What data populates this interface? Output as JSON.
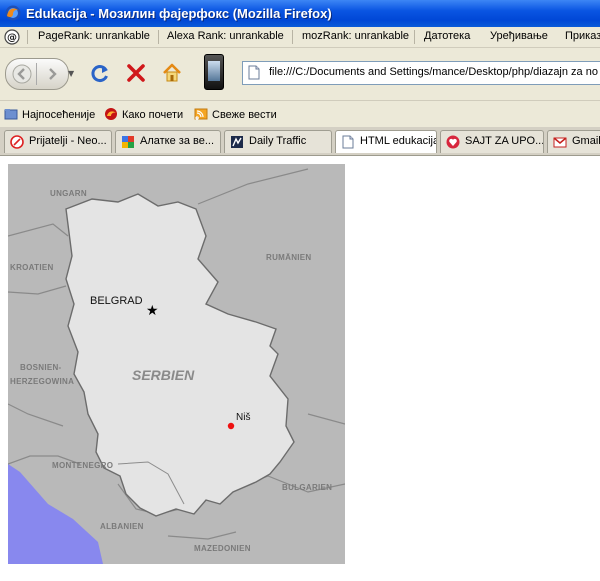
{
  "window": {
    "title": "Edukacija - Мозилин фајерфокс (Mozilla Firefox)"
  },
  "seo_toolbar": {
    "pagerank": "PageRank: unrankable",
    "alexa": "Alexa Rank: unrankable",
    "mozrank": "mozRank: unrankable",
    "menu_file": "Датотека",
    "menu_edit": "Уређивање",
    "menu_view": "Приказ"
  },
  "nav": {
    "url": "file:///C:/Documents and Settings/mance/Desktop/php/diazajn za no"
  },
  "bookmarks": [
    {
      "label": "Најпосећеније",
      "icon": "bookmark-folder-icon"
    },
    {
      "label": "Како почети",
      "icon": "firefox-red-icon"
    },
    {
      "label": "Свеже вести",
      "icon": "rss-feed-icon"
    }
  ],
  "tabs": [
    {
      "label": "Prijatelji - Neo...",
      "icon": "neo-icon"
    },
    {
      "label": "Алатке за ве...",
      "icon": "google-icon"
    },
    {
      "label": "Daily Traffic",
      "icon": "traffic-icon"
    },
    {
      "label": "HTML edukacija",
      "icon": "page-icon"
    },
    {
      "label": "SAJT ZA UPO...",
      "icon": "heart-icon"
    },
    {
      "label": "Gmail",
      "icon": "gmail-icon"
    }
  ],
  "map": {
    "labels": {
      "ungarn": "UNGARN",
      "rumanien": "RUMÄNIEN",
      "kroatien": "KROATIEN",
      "bosnien1": "BOSNIEN-",
      "bosnien2": "HERZEGOWINA",
      "montenegro": "MONTENEGRO",
      "bulgarien": "BULGARIEN",
      "albanien": "ALBANIEN",
      "mazedonien": "MAZEDONIEN",
      "serbien": "SERBIEN",
      "belgrad": "BELGRAD",
      "nis": "Niš"
    },
    "colors": {
      "neighbors": "#b9b9b9",
      "serbia": "#e4e4e4",
      "sea": "#8888ee",
      "nis_marker": "#ee1111"
    }
  }
}
